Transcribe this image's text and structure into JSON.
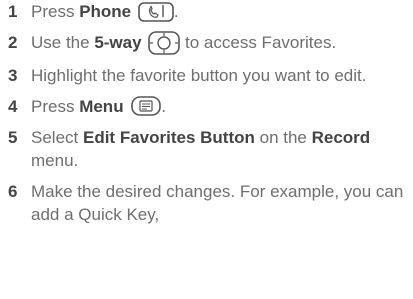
{
  "steps": [
    {
      "number": "1",
      "pre": "Press ",
      "bold1": "Phone",
      "icon": "phone-key-icon",
      "post": "."
    },
    {
      "number": "2",
      "pre": "Use the ",
      "bold1": "5-way",
      "icon": "five-way-navigator-icon",
      "post": " to access Favorites."
    },
    {
      "number": "3",
      "text": "Highlight the favorite button you want to edit."
    },
    {
      "number": "4",
      "pre": "Press ",
      "bold1": "Menu",
      "icon": "menu-key-icon",
      "post": "."
    },
    {
      "number": "5",
      "pre": "Select ",
      "bold1": "Edit Favorites Button",
      "mid": " on the ",
      "bold2": "Record",
      "post": " menu."
    },
    {
      "number": "6",
      "text": "Make the desired changes. For example, you can add a Quick Key,"
    }
  ],
  "colors": {
    "text": "#6e6e6e",
    "bold": "#444444"
  }
}
